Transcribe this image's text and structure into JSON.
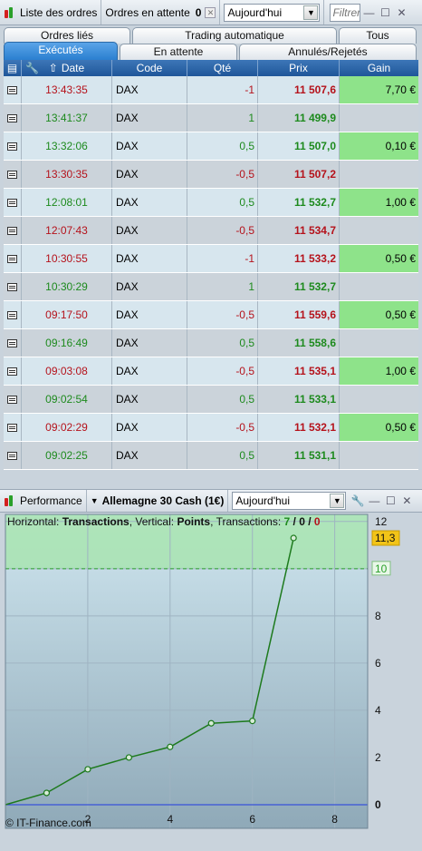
{
  "top_toolbar": {
    "title": "Liste des ordres",
    "pending_label": "Ordres en attente",
    "pending_count": "0",
    "period_value": "Aujourd'hui",
    "filter_placeholder": "Filtrer"
  },
  "tabs_row1": [
    {
      "label": "Ordres liés"
    },
    {
      "label": "Trading automatique"
    },
    {
      "label": "Tous"
    }
  ],
  "tabs_row2": [
    {
      "label": "Exécutés",
      "active": true
    },
    {
      "label": "En attente"
    },
    {
      "label": "Annulés/Rejetés"
    }
  ],
  "table": {
    "columns": [
      "Date",
      "Code",
      "Qté",
      "Prix",
      "Gain"
    ],
    "rows": [
      {
        "time": "13:43:35",
        "code": "DAX",
        "qty": "-1",
        "price": "11 507,6",
        "gain": "7,70 €"
      },
      {
        "time": "13:41:37",
        "code": "DAX",
        "qty": "1",
        "price": "11 499,9",
        "gain": ""
      },
      {
        "time": "13:32:06",
        "code": "DAX",
        "qty": "0,5",
        "price": "11 507,0",
        "gain": "0,10 €"
      },
      {
        "time": "13:30:35",
        "code": "DAX",
        "qty": "-0,5",
        "price": "11 507,2",
        "gain": ""
      },
      {
        "time": "12:08:01",
        "code": "DAX",
        "qty": "0,5",
        "price": "11 532,7",
        "gain": "1,00 €"
      },
      {
        "time": "12:07:43",
        "code": "DAX",
        "qty": "-0,5",
        "price": "11 534,7",
        "gain": ""
      },
      {
        "time": "10:30:55",
        "code": "DAX",
        "qty": "-1",
        "price": "11 533,2",
        "gain": "0,50 €"
      },
      {
        "time": "10:30:29",
        "code": "DAX",
        "qty": "1",
        "price": "11 532,7",
        "gain": ""
      },
      {
        "time": "09:17:50",
        "code": "DAX",
        "qty": "-0,5",
        "price": "11 559,6",
        "gain": "0,50 €"
      },
      {
        "time": "09:16:49",
        "code": "DAX",
        "qty": "0,5",
        "price": "11 558,6",
        "gain": ""
      },
      {
        "time": "09:03:08",
        "code": "DAX",
        "qty": "-0,5",
        "price": "11 535,1",
        "gain": "1,00 €"
      },
      {
        "time": "09:02:54",
        "code": "DAX",
        "qty": "0,5",
        "price": "11 533,1",
        "gain": ""
      },
      {
        "time": "09:02:29",
        "code": "DAX",
        "qty": "-0,5",
        "price": "11 532,1",
        "gain": "0,50 €"
      },
      {
        "time": "09:02:25",
        "code": "DAX",
        "qty": "0,5",
        "price": "11 531,1",
        "gain": ""
      }
    ]
  },
  "perf_toolbar": {
    "title": "Performance",
    "instrument": "Allemagne 30 Cash (1€)",
    "period_value": "Aujourd'hui"
  },
  "legend": {
    "h_label": "Horizontal:",
    "h_value": "Transactions",
    "v_label": "Vertical:",
    "v_value": "Points",
    "t_label": "Transactions:",
    "t_a": "7",
    "sep1": " / ",
    "t_b": "0",
    "sep2": " / ",
    "t_c": "0"
  },
  "copyright": "© IT-Finance.com",
  "colors": {
    "header_blue": "#2a67a9",
    "tab_active": "#3c8fdc",
    "positive": "#1d8a1d",
    "negative": "#b5121b",
    "gain_bg": "#8ee38a",
    "target_bg": "#a8e4b0",
    "last_badge": "#f2c418"
  },
  "chart_data": {
    "type": "line",
    "x": [
      0,
      1,
      2,
      3,
      4,
      5,
      6,
      7
    ],
    "y": [
      0,
      0.5,
      1.5,
      2.0,
      2.45,
      3.45,
      3.55,
      11.3
    ],
    "xlim": [
      0,
      8.8
    ],
    "ylim": [
      -1,
      12.3
    ],
    "xticks": [
      2,
      4,
      6,
      8
    ],
    "yticks": [
      0,
      2,
      4,
      6,
      8,
      10,
      12
    ],
    "last_value": "11,3",
    "target_value": 10,
    "target_label": "10",
    "zero_line": 0
  }
}
